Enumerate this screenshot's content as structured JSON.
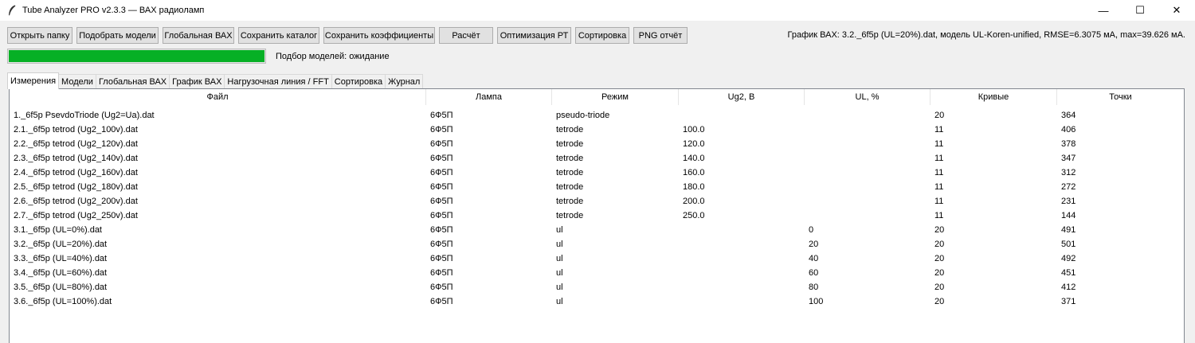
{
  "window": {
    "title": "Tube Analyzer PRO v2.3.3 — ВАХ радиоламп",
    "icon": "feather-icon",
    "controls": {
      "minimize": "—",
      "maximize": "☐",
      "close": "✕"
    }
  },
  "toolbar": {
    "buttons": [
      "Открыть папку",
      "Подобрать модели",
      "Глобальная ВАХ",
      "Сохранить каталог",
      "Сохранить коэффициенты",
      "Расчёт",
      "Оптимизация РТ",
      "Сортировка",
      "PNG отчёт"
    ]
  },
  "status": {
    "right_text": "График ВАХ: 3.2._6f5p (UL=20%).dat, модель UL-Koren-unified, RMSE=6.3075 мА, max=39.626 мА.",
    "progress_label": "Подбор моделей: ожидание",
    "progress_fraction": 1.0,
    "progress_color": "#06b025"
  },
  "tabs": [
    "Измерения",
    "Модели",
    "Глобальная ВАХ",
    "График ВАХ",
    "Нагрузочная линия / FFT",
    "Сортировка",
    "Журнал"
  ],
  "active_tab": 0,
  "table": {
    "columns": [
      "Файл",
      "Лампа",
      "Режим",
      "Ug2, В",
      "UL, %",
      "Кривые",
      "Точки"
    ],
    "rows": [
      [
        "1._6f5p PsevdoTriode (Ug2=Ua).dat",
        "6Ф5П",
        "pseudo-triode",
        "",
        "",
        "20",
        "364"
      ],
      [
        "2.1._6f5p tetrod (Ug2_100v).dat",
        "6Ф5П",
        "tetrode",
        "100.0",
        "",
        "11",
        "406"
      ],
      [
        "2.2._6f5p tetrod (Ug2_120v).dat",
        "6Ф5П",
        "tetrode",
        "120.0",
        "",
        "11",
        "378"
      ],
      [
        "2.3._6f5p tetrod (Ug2_140v).dat",
        "6Ф5П",
        "tetrode",
        "140.0",
        "",
        "11",
        "347"
      ],
      [
        "2.4._6f5p tetrod (Ug2_160v).dat",
        "6Ф5П",
        "tetrode",
        "160.0",
        "",
        "11",
        "312"
      ],
      [
        "2.5._6f5p tetrod (Ug2_180v).dat",
        "6Ф5П",
        "tetrode",
        "180.0",
        "",
        "11",
        "272"
      ],
      [
        "2.6._6f5p tetrod (Ug2_200v).dat",
        "6Ф5П",
        "tetrode",
        "200.0",
        "",
        "11",
        "231"
      ],
      [
        "2.7._6f5p tetrod (Ug2_250v).dat",
        "6Ф5П",
        "tetrode",
        "250.0",
        "",
        "11",
        "144"
      ],
      [
        "3.1._6f5p (UL=0%).dat",
        "6Ф5П",
        "ul",
        "",
        "0",
        "20",
        "491"
      ],
      [
        "3.2._6f5p (UL=20%).dat",
        "6Ф5П",
        "ul",
        "",
        "20",
        "20",
        "501"
      ],
      [
        "3.3._6f5p (UL=40%).dat",
        "6Ф5П",
        "ul",
        "",
        "40",
        "20",
        "492"
      ],
      [
        "3.4._6f5p (UL=60%).dat",
        "6Ф5П",
        "ul",
        "",
        "60",
        "20",
        "451"
      ],
      [
        "3.5._6f5p (UL=80%).dat",
        "6Ф5П",
        "ul",
        "",
        "80",
        "20",
        "412"
      ],
      [
        "3.6._6f5p (UL=100%).dat",
        "6Ф5П",
        "ul",
        "",
        "100",
        "20",
        "371"
      ]
    ]
  }
}
